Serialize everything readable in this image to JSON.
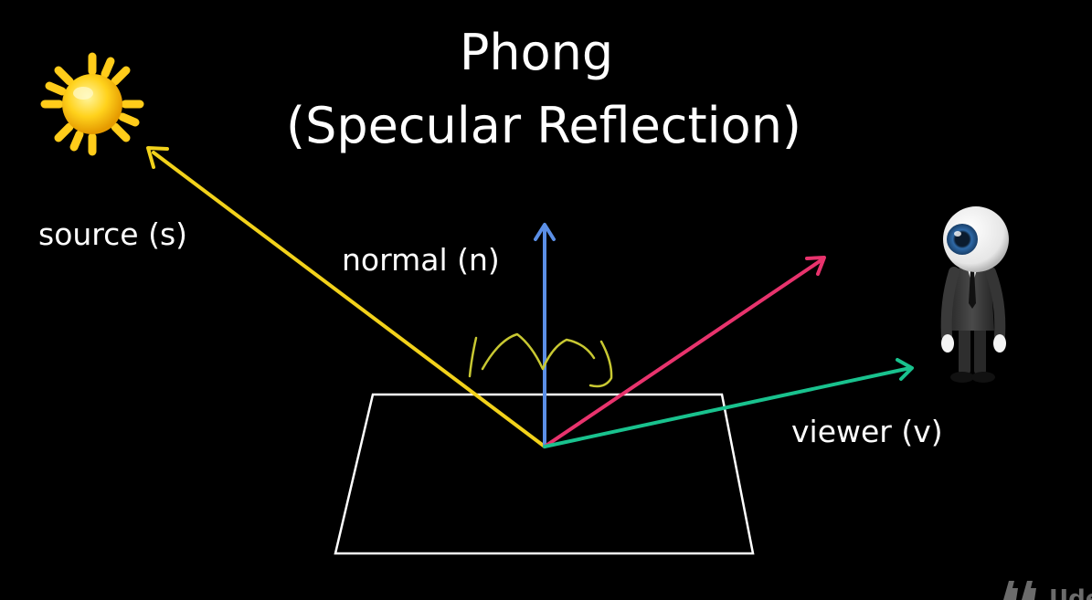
{
  "title": {
    "line1": "Phong",
    "line2": "(Specular Reflection)"
  },
  "vectors": {
    "source": {
      "label": "source (s)",
      "color": "#f2d21b"
    },
    "normal": {
      "label": "normal (n)",
      "color": "#5b8fe6"
    },
    "reflection": {
      "color": "#e8336d"
    },
    "viewer": {
      "label": "viewer (v)",
      "color": "#19c28e"
    }
  },
  "annotation": {
    "color": "#c8c832"
  },
  "surface": {
    "color": "#ffffff"
  },
  "icons": {
    "source": "sun-icon",
    "viewer": "eyeball-figure-icon",
    "watermark": "udemy-logo-icon"
  },
  "watermark": {
    "text": "Ude"
  }
}
